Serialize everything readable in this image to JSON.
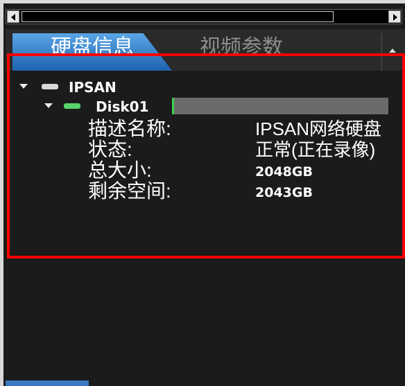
{
  "tabs": [
    {
      "label": "硬盘信息",
      "active": true
    },
    {
      "label": "视频参数",
      "active": false
    }
  ],
  "tree": {
    "root": {
      "label": "IPSAN",
      "icon": "disk-grey-icon",
      "expanded": true
    },
    "child": {
      "label": "Disk01",
      "icon": "disk-green-icon",
      "expanded": true,
      "usage_fraction": 0.01
    }
  },
  "properties": [
    {
      "key": "描述名称:",
      "value": "IPSAN网络硬盘"
    },
    {
      "key": "状态:",
      "value": "正常(正在录像)"
    },
    {
      "key": "总大小:",
      "value": "2048GB"
    },
    {
      "key": "剩余空间:",
      "value": "2043GB"
    }
  ],
  "colors": {
    "background": "#1b1b1b",
    "active_tab": "#3d86d0",
    "highlight_border": "#ff0000",
    "usage_fill": "#3ad04c"
  }
}
